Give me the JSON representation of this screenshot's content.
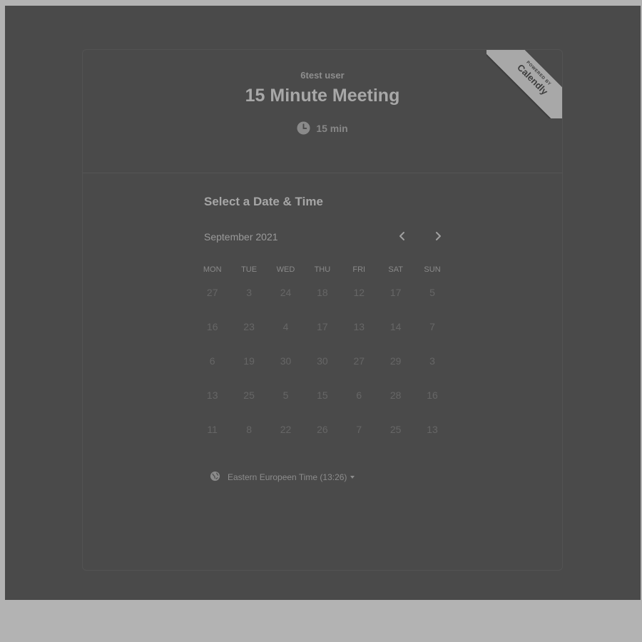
{
  "header": {
    "owner_name": "6test user",
    "event_title": "15 Minute Meeting",
    "duration": "15 min"
  },
  "ribbon": {
    "powered_by": "POWERED BY",
    "brand": "Calendly"
  },
  "calendar": {
    "section_title": "Select a Date & Time",
    "month_label": "September 2021",
    "weekdays": [
      "MON",
      "TUE",
      "WED",
      "THU",
      "FRI",
      "SAT",
      "SUN"
    ],
    "weeks": [
      [
        "27",
        "3",
        "24",
        "18",
        "12",
        "17",
        "5"
      ],
      [
        "16",
        "23",
        "4",
        "17",
        "13",
        "14",
        "7"
      ],
      [
        "6",
        "19",
        "30",
        "30",
        "27",
        "29",
        "3"
      ],
      [
        "13",
        "25",
        "5",
        "15",
        "6",
        "28",
        "16"
      ],
      [
        "11",
        "8",
        "22",
        "26",
        "7",
        "25",
        "13"
      ]
    ]
  },
  "timezone": {
    "label": "Eastern Europeen Time (13:26)"
  },
  "icons": {
    "clock": "clock-icon",
    "globe": "globe-icon",
    "prev": "chevron-left-icon",
    "next": "chevron-right-icon",
    "caret": "caret-down-icon"
  }
}
